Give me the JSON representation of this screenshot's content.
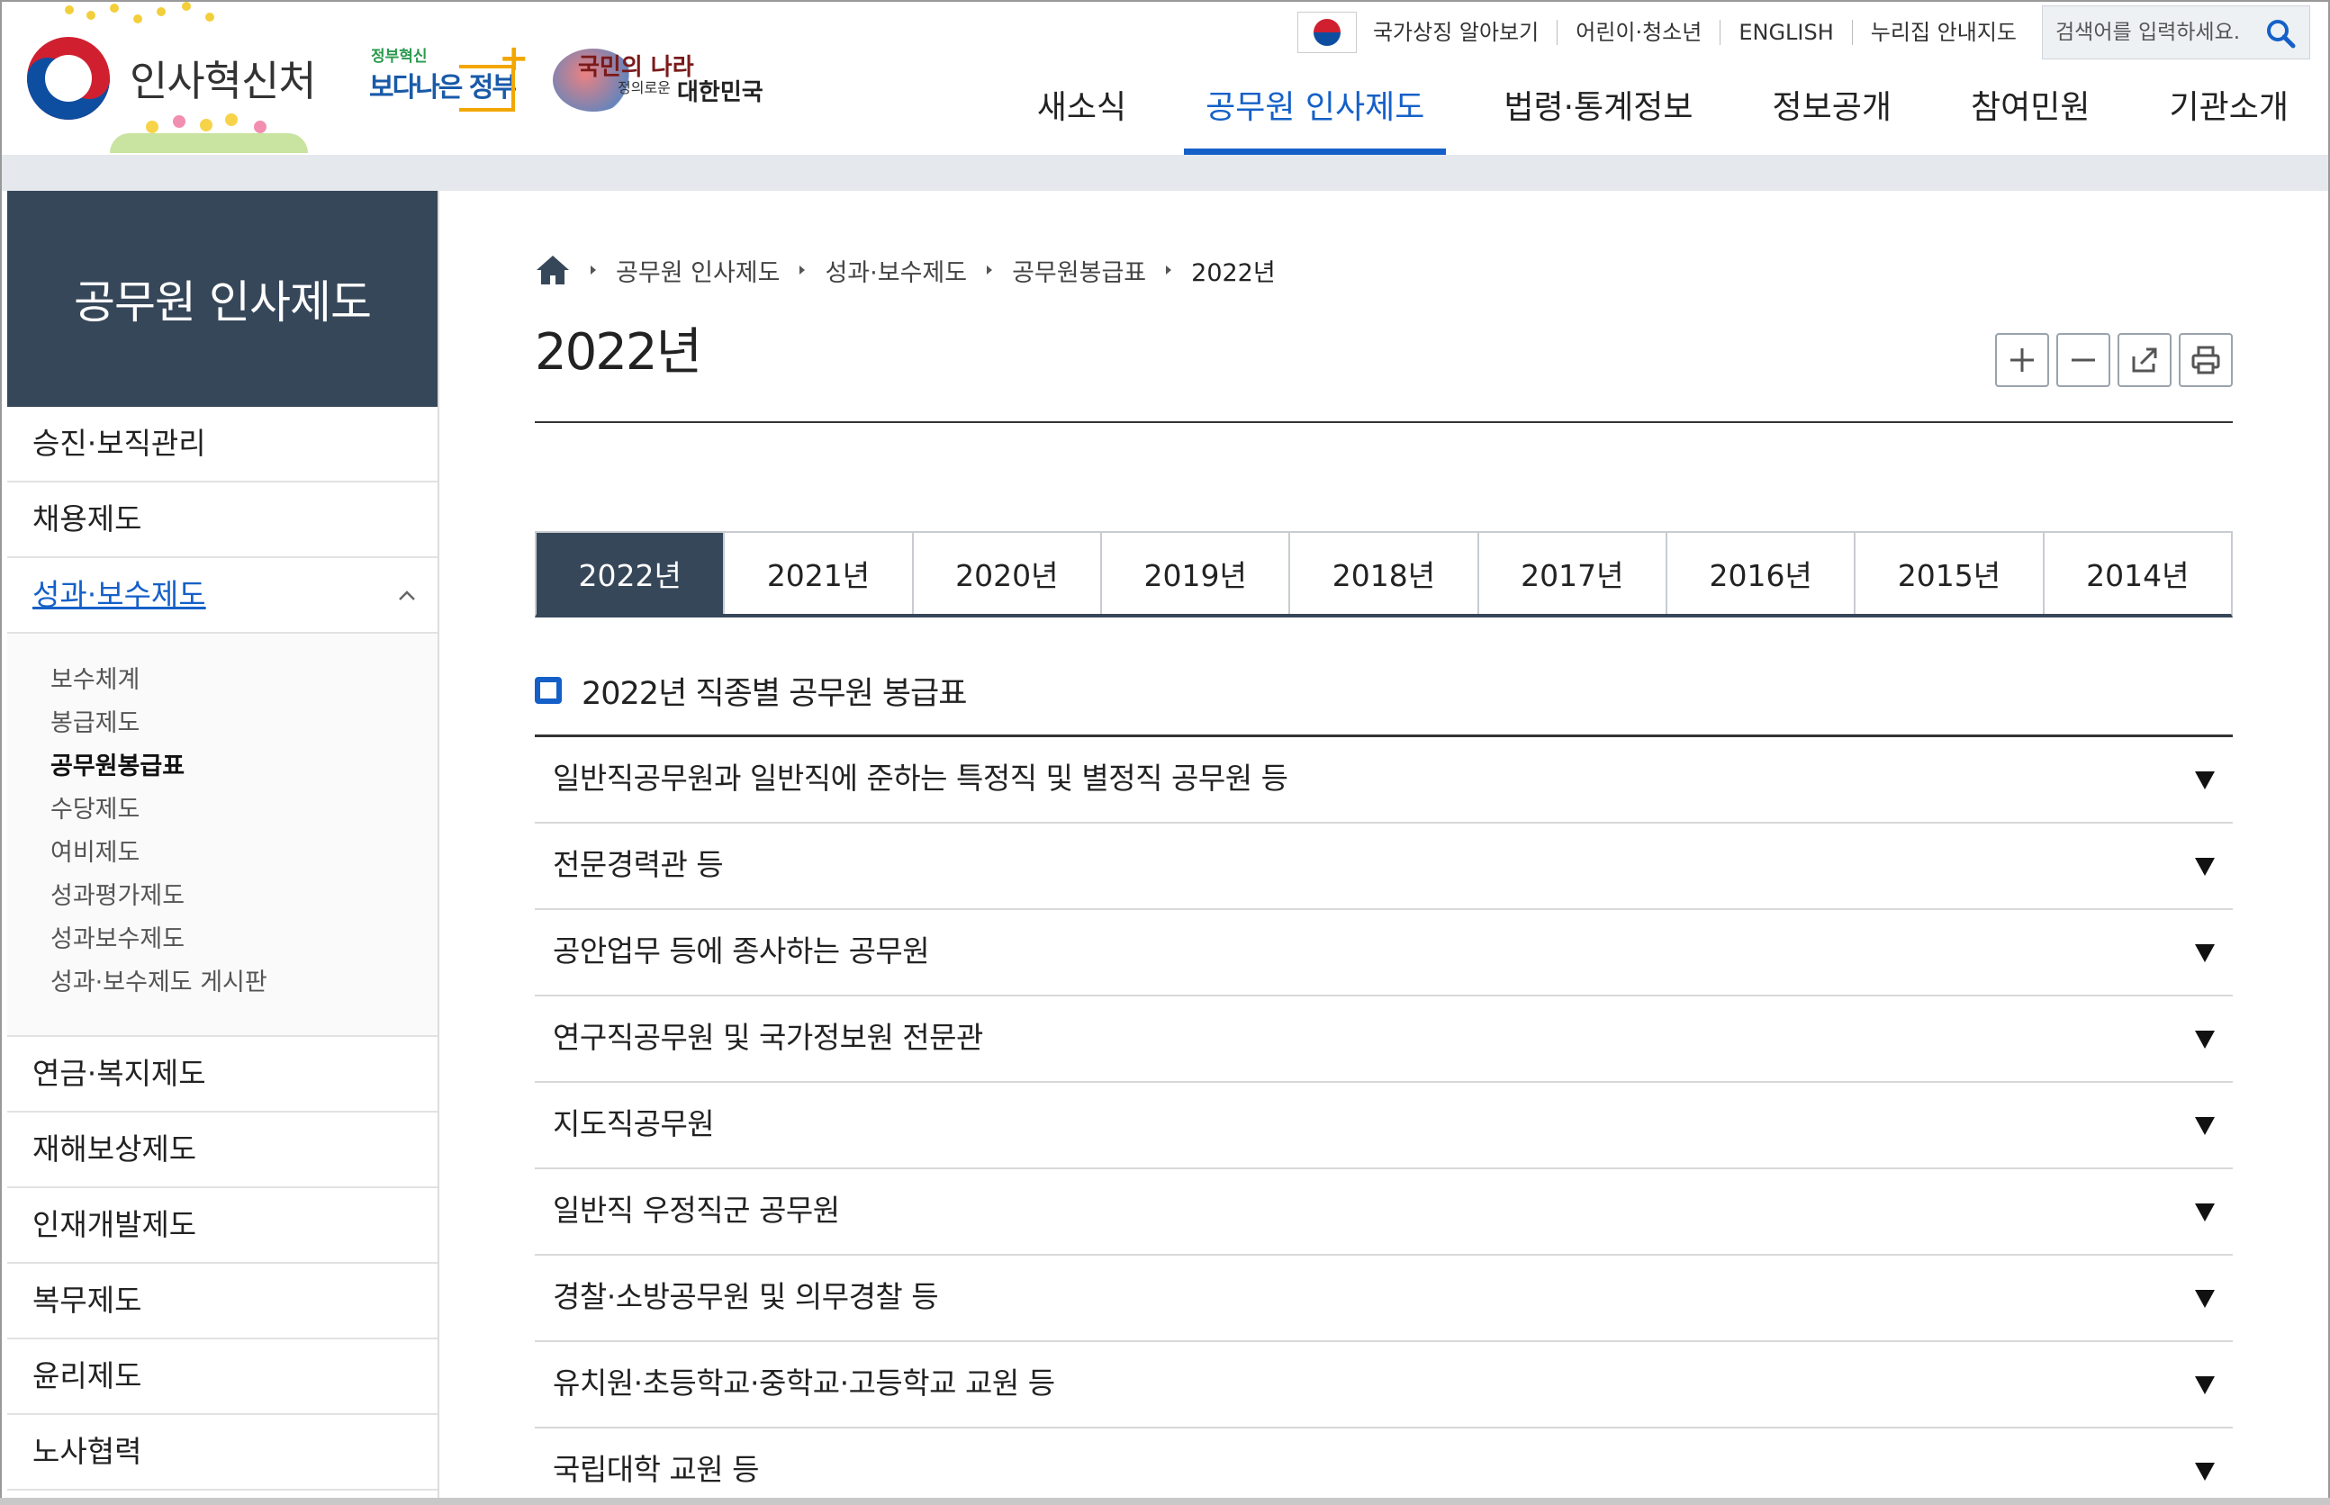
{
  "header": {
    "org_name": "인사혁신처",
    "slogan1_small": "정부혁신",
    "slogan1_big": "보다나은 정부",
    "slogan2_line1": "국민의 나라",
    "slogan2_line2": "정의로운",
    "slogan2_line3": "대한민국",
    "utility": {
      "national_symbol": "국가상징 알아보기",
      "kids": "어린이·청소년",
      "english": "ENGLISH",
      "sitemap": "누리집 안내지도"
    },
    "search": {
      "placeholder": "검색어를 입력하세요.",
      "icon": "search-icon"
    },
    "gnb": [
      "새소식",
      "공무원 인사제도",
      "법령·통계정보",
      "정보공개",
      "참여민원",
      "기관소개"
    ],
    "gnb_active_index": 1
  },
  "lnb": {
    "title": "공무원 인사제도",
    "items_top": [
      "승진·보직관리",
      "채용제도"
    ],
    "open_item": "성과·보수제도",
    "sub_items": [
      "보수체계",
      "봉급제도",
      "공무원봉급표",
      "수당제도",
      "여비제도",
      "성과평가제도",
      "성과보수제도",
      "성과·보수제도 게시판"
    ],
    "sub_current_index": 2,
    "items_bottom": [
      "연금·복지제도",
      "재해보상제도",
      "인재개발제도",
      "복무제도",
      "윤리제도",
      "노사협력"
    ]
  },
  "content": {
    "breadcrumb": [
      "공무원 인사제도",
      "성과·보수제도",
      "공무원봉급표",
      "2022년"
    ],
    "page_title": "2022년",
    "tools": [
      "zoom-in-icon",
      "zoom-out-icon",
      "share-icon",
      "print-icon"
    ],
    "year_tabs": [
      "2022년",
      "2021년",
      "2020년",
      "2019년",
      "2018년",
      "2017년",
      "2016년",
      "2015년",
      "2014년"
    ],
    "active_year_index": 0,
    "section_title": "2022년 직종별 공무원 봉급표",
    "accordion": [
      "일반직공무원과 일반직에 준하는 특정직 및 별정직 공무원 등",
      "전문경력관 등",
      "공안업무 등에 종사하는 공무원",
      "연구직공무원 및 국가정보원 전문관",
      "지도직공무원",
      "일반직 우정직군 공무원",
      "경찰·소방공무원 및 의무경찰 등",
      "유치원·초등학교·중학교·고등학교 교원 등",
      "국립대학 교원 등"
    ]
  },
  "colors": {
    "accent": "#1560c8",
    "navy": "#37475a",
    "band": "#e5e8ec"
  }
}
